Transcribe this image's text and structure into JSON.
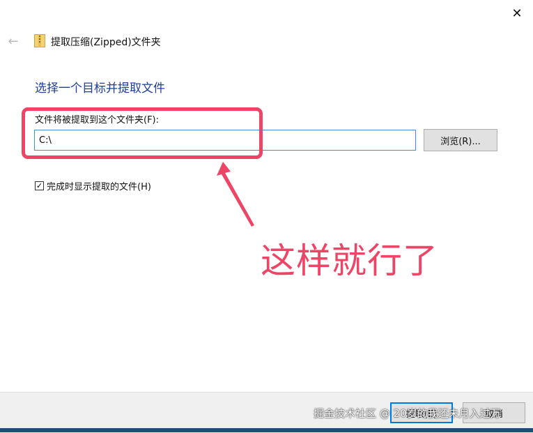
{
  "titlebar": {
    "close_glyph": "✕"
  },
  "nav": {
    "back_glyph": "←",
    "icon": "zip-folder-icon",
    "title": "提取压缩(Zipped)文件夹"
  },
  "main": {
    "heading": "选择一个目标并提取文件",
    "destination_label": "文件将被提取到这个文件夹(F):",
    "destination_value": "C:\\",
    "browse_label": "浏览(R)...",
    "checkbox_checked": true,
    "checkbox_glyph": "✓",
    "checkbox_label": "完成时显示提取的文件(H)"
  },
  "annotation": {
    "text": "这样就行了",
    "color": "#ee4466"
  },
  "footer": {
    "extract_label": "提取(E)",
    "cancel_label": "取消"
  },
  "watermark": "掘金技术社区 @ 20岁的我还未月入过万",
  "colors": {
    "accent": "#0078d7",
    "heading": "#1f3d9a"
  }
}
